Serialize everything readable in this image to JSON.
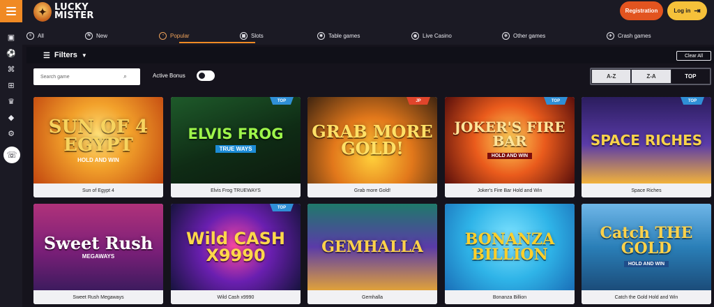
{
  "header": {
    "logo_line1": "LUCKY",
    "logo_line2": "MISTER",
    "registration_label": "Registration",
    "login_label": "Log in"
  },
  "nav": [
    {
      "label": "All",
      "icon": "all-icon",
      "glyph": "≡"
    },
    {
      "label": "New",
      "icon": "new-icon",
      "glyph": "N"
    },
    {
      "label": "Popular",
      "icon": "popular-icon",
      "glyph": "◔",
      "active": true
    },
    {
      "label": "Slots",
      "icon": "slots-icon",
      "glyph": "▦"
    },
    {
      "label": "Table games",
      "icon": "table-games-icon",
      "glyph": "✱"
    },
    {
      "label": "Live Casino",
      "icon": "live-casino-icon",
      "glyph": "◉"
    },
    {
      "label": "Other games",
      "icon": "other-games-icon",
      "glyph": "✲"
    },
    {
      "label": "Crash games",
      "icon": "crash-games-icon",
      "glyph": "✈"
    }
  ],
  "sidebar": {
    "icons": [
      "slot-machine-icon",
      "sports-ball-icon",
      "gamepad-icon",
      "gift-icon",
      "trophy-icon",
      "diamond-icon",
      "settings-icon",
      "support-icon"
    ]
  },
  "filters": {
    "label": "Filters",
    "clear_all": "Clear All",
    "search_placeholder": "Search game",
    "active_bonus_label": "Active Bonus",
    "active_bonus_on": false,
    "sort_options": [
      "A-Z",
      "Z-A",
      "TOP"
    ],
    "sort_selected": "TOP"
  },
  "games": [
    {
      "name": "Sun of Egypt 4",
      "thumb_title": "SUN OF 4 EGYPT",
      "thumb_sub": "HOLD AND WIN",
      "badge": ""
    },
    {
      "name": "Elvis Frog TRUEWAYS",
      "thumb_title": "ELVIS FROG",
      "thumb_sub": "TRUE WAYS",
      "badge": "TOP"
    },
    {
      "name": "Grab more Gold!",
      "thumb_title": "GRAB MORE GOLD!",
      "thumb_sub": "",
      "badge": "JP"
    },
    {
      "name": "Joker's Fire Bar Hold and Win",
      "thumb_title": "JOKER'S FIRE BAR",
      "thumb_sub": "HOLD AND WIN",
      "badge": "TOP"
    },
    {
      "name": "Space Riches",
      "thumb_title": "SPACE RICHES",
      "thumb_sub": "",
      "badge": "TOP"
    },
    {
      "name": "Sweet Rush Megaways",
      "thumb_title": "Sweet Rush",
      "thumb_sub": "MEGAWAYS",
      "badge": ""
    },
    {
      "name": "Wild Cash x9990",
      "thumb_title": "Wild CASH X9990",
      "thumb_sub": "",
      "badge": "TOP"
    },
    {
      "name": "Gemhalla",
      "thumb_title": "GEMHALLA",
      "thumb_sub": "",
      "badge": ""
    },
    {
      "name": "Bonanza Billion",
      "thumb_title": "BONANZA BILLION",
      "thumb_sub": "",
      "badge": ""
    },
    {
      "name": "Catch the Gold Hold and Win",
      "thumb_title": "Catch THE GOLD",
      "thumb_sub": "HOLD AND WIN",
      "badge": ""
    }
  ],
  "colors": {
    "accent_orange": "#f08a24",
    "registration_bg": "#e2541f",
    "login_bg": "#f6c13a",
    "badge_top": "#2f8fd6",
    "badge_jp": "#e0452b",
    "page_bg": "#15131c"
  }
}
